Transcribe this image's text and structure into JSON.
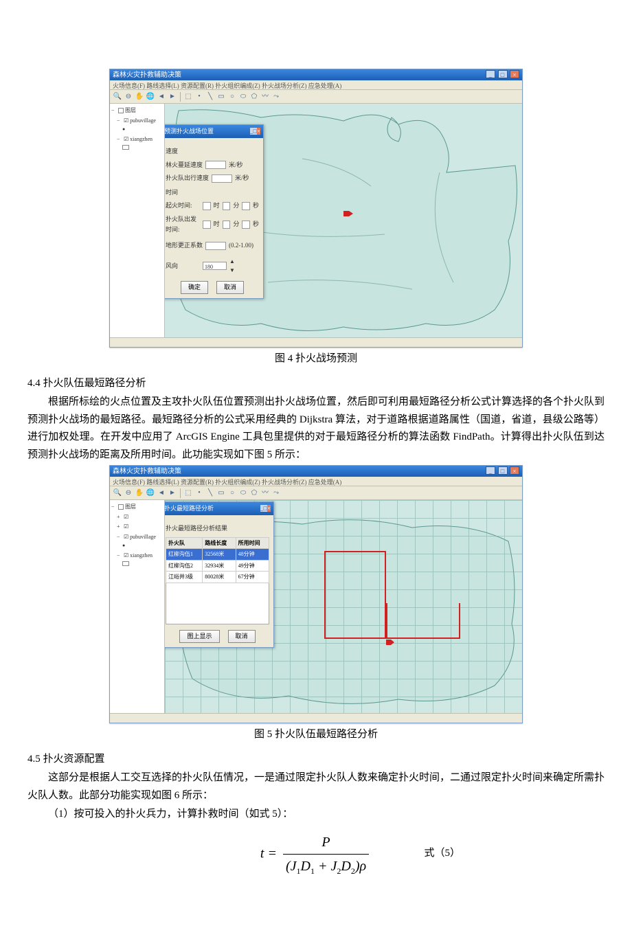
{
  "fig4": {
    "window_title": "森林火灾扑救辅助决策",
    "menu_items": "火场信息(F) 路线选择(L) 资源配置(R) 扑火组织编成(Z) 扑火战场分析(Z) 应急处理(A)",
    "toc": [
      "图层",
      "☑ pubuvillage",
      "☑ xiangzhen"
    ],
    "dialog_title": "预测扑火战场位置",
    "section_speed": "速度",
    "label_spread": "林火蔓延速度",
    "unit_spread": "米/秒",
    "label_travel": "扑火队出行速度",
    "unit_travel": "米/秒",
    "section_time": "时间",
    "label_fire_time": "起火时间:",
    "label_depart_time": "扑火队出发时间:",
    "label_terrain": "地形更正系数",
    "terrain_range": "(0.2-1.00)",
    "label_windangle": "风向",
    "windangle_value": "180",
    "ok_btn": "确定",
    "cancel_btn": "取消",
    "caption": "图 4  扑火战场预测"
  },
  "section44": {
    "heading": "4.4  扑火队伍最短路径分析",
    "para": "根据所标绘的火点位置及主攻扑火队伍位置预测出扑火战场位置，然后即可利用最短路径分析公式计算选择的各个扑火队到预测扑火战场的最短路径。最短路径分析的公式采用经典的 Dijkstra 算法，对于道路根据道路属性（国道，省道，县级公路等）进行加权处理。在开发中应用了 ArcGIS Engine 工具包里提供的对于最短路径分析的算法函数 FindPath。计算得出扑火队伍到达预测扑火战场的距离及所用时间。此功能实现如下图 5 所示："
  },
  "fig5": {
    "window_title": "森林火灾扑救辅助决策",
    "dialog_title": "扑火最短路径分析",
    "result_header": "扑火最短路径分析结果",
    "cols": [
      "扑火队",
      "路线长度",
      "所用时间"
    ],
    "rows": [
      [
        "红柳沟伍1",
        "32568米",
        "48分钟"
      ],
      [
        "红柳沟伍2",
        "32934米",
        "49分钟"
      ],
      [
        "江峪井3级",
        "80028米",
        "67分钟"
      ]
    ],
    "display_btn": "图上显示",
    "cancel_btn": "取消",
    "caption": "图 5  扑火队伍最短路径分析"
  },
  "section45": {
    "heading": "4.5  扑火资源配置",
    "para1": "这部分是根据人工交互选择的扑火队伍情况，一是通过限定扑火队人数来确定扑火时间，二通过限定扑火时间来确定所需扑火队人数。此部分功能实现如图 6 所示：",
    "para2": "（1）按可投入的扑火兵力，计算扑救时间（如式 5）：",
    "eq_label": "式（5）"
  }
}
